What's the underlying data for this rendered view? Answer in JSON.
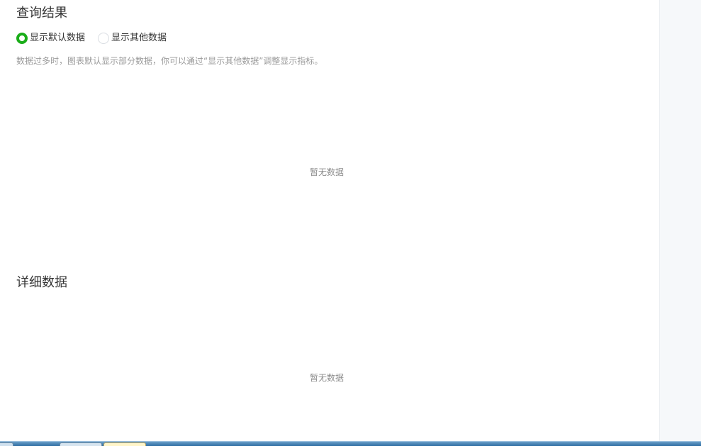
{
  "query_results": {
    "title": "查询结果",
    "radio_options": [
      {
        "label": "显示默认数据",
        "checked": true
      },
      {
        "label": "显示其他数据",
        "checked": false
      }
    ],
    "hint": "数据过多时，图表默认显示部分数据，你可以通过“显示其他数据”调整显示指标。",
    "empty_text": "暂无数据"
  },
  "details": {
    "title": "详细数据",
    "empty_text": "暂无数据"
  },
  "colors": {
    "accent": "#1aad19",
    "hint_text": "#9a9a9a",
    "side_panel": "#f6f8fa"
  }
}
